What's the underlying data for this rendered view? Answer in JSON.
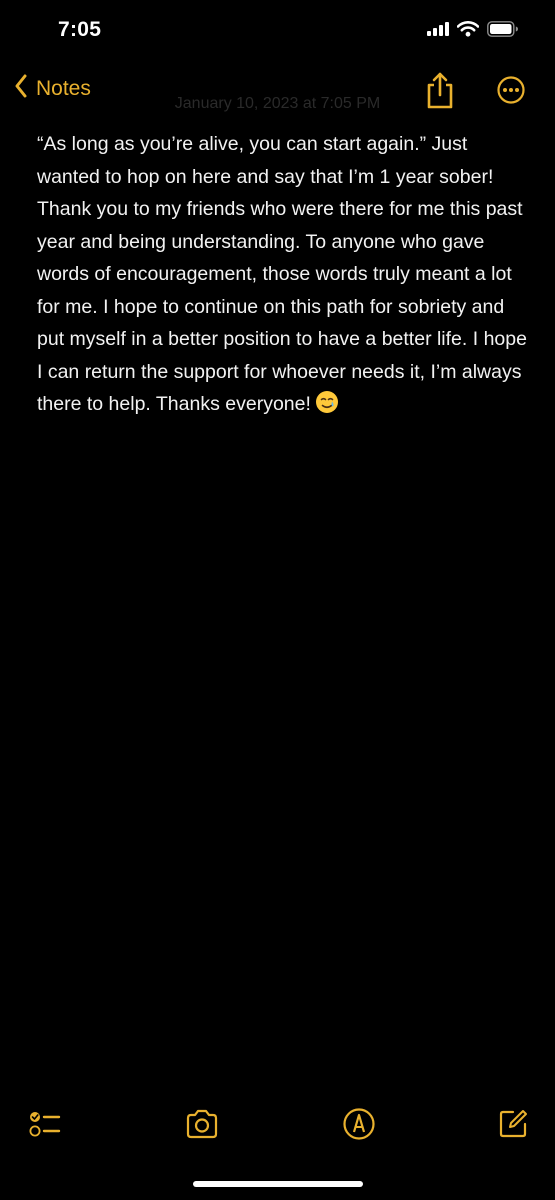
{
  "status_bar": {
    "time": "7:05"
  },
  "nav": {
    "back_label": "Notes",
    "date": "January 10, 2023 at 7:05 PM"
  },
  "note": {
    "text": "“As long as you’re alive, you can start again.” Just wanted to hop on here and say that I’m 1 year sober! Thank you to my friends who were there for me this past year and being understanding. To anyone who gave words of encouragement, those words truly meant a lot for me. I hope to continue on this path for sobriety and put myself in a better position to have a better life. I hope I can return the support for whoever needs it, I’m always there to help. Thanks everyone!",
    "emoji": "smiling-face-with-tear"
  },
  "icons": {
    "signal": "cellular-signal-icon",
    "wifi": "wifi-icon",
    "battery": "battery-icon",
    "back": "chevron-left-icon",
    "share": "share-icon",
    "more": "ellipsis-circle-icon",
    "checklist": "checklist-icon",
    "camera": "camera-icon",
    "markup": "markup-pen-icon",
    "compose": "compose-icon"
  },
  "colors": {
    "background": "#000000",
    "accent": "#E9B12E",
    "text": "#F2F2F2"
  }
}
